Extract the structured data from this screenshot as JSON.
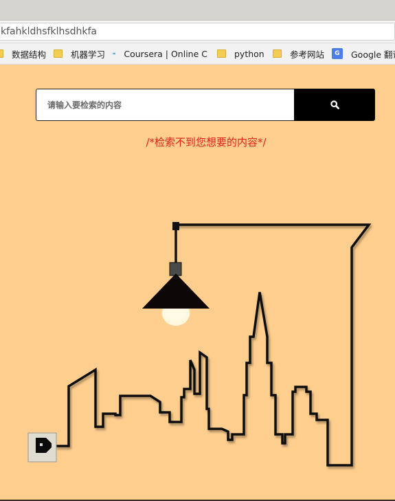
{
  "browser": {
    "url_text": "kfahkldhsfklhsdhkfa",
    "bookmarks": [
      {
        "label": "数据结构",
        "icon": "folder-icon"
      },
      {
        "label": "机器学习",
        "icon": "folder-icon"
      },
      {
        "label": "Coursera | Online C",
        "icon": "coursera-icon"
      },
      {
        "label": "python",
        "icon": "folder-icon"
      },
      {
        "label": "参考网站",
        "icon": "folder-icon"
      },
      {
        "label": "Google 翻译",
        "icon": "google-translate-icon"
      }
    ]
  },
  "search": {
    "placeholder": "请输入要检索的内容",
    "value": "",
    "button_icon": "search-icon"
  },
  "message": "/*检索不到您想要的内容*/",
  "illustration": {
    "description_icon": "city-skyline-lamp-icon",
    "plug_icon": "plug-icon",
    "lamp_icon": "hanging-lamp-icon"
  },
  "colors": {
    "background": "#fece8e",
    "accent_button": "#000000",
    "message_color": "#e0221b",
    "line_color": "#111111",
    "bulb_glow": "#fff6c8"
  }
}
